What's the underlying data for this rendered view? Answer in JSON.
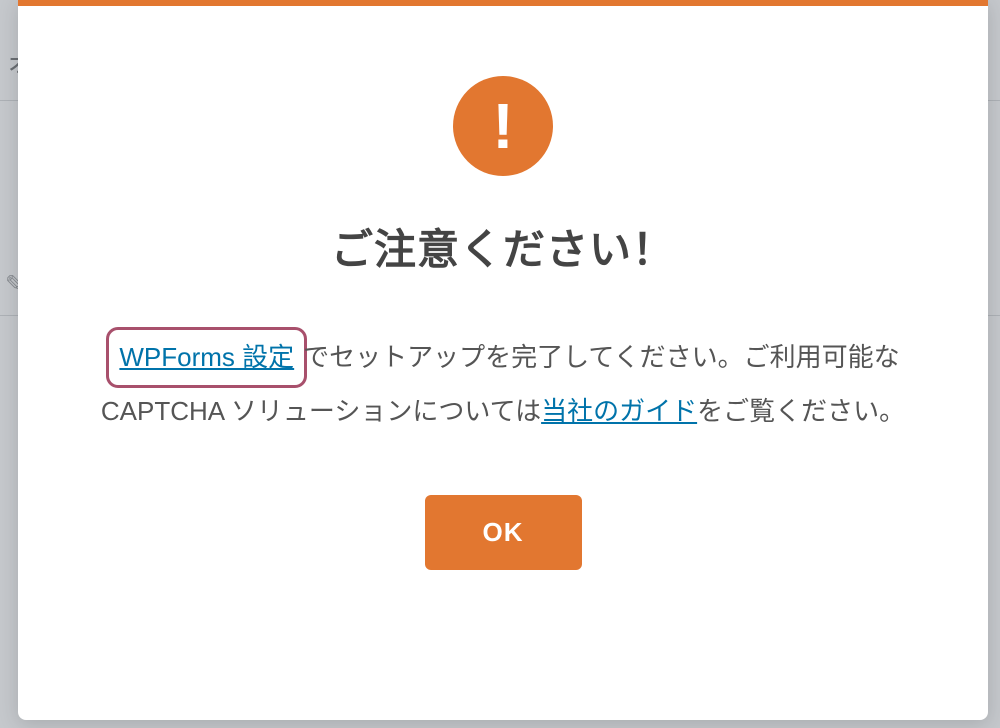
{
  "backdrop": {
    "partial_text_top": "ォ",
    "partial_icon": "✎"
  },
  "modal": {
    "title": "ご注意ください！",
    "body": {
      "link1_text": "WPForms 設定",
      "text_after_link1": "でセットアップを完了してください。ご利用可能な CAPTCHA ソリューションについては",
      "link2_text": "当社のガイド",
      "text_after_link2": "をご覧ください。"
    },
    "ok_button_label": "OK"
  },
  "colors": {
    "accent": "#e27730",
    "link": "#0073aa",
    "highlight_border": "#a8506c"
  }
}
